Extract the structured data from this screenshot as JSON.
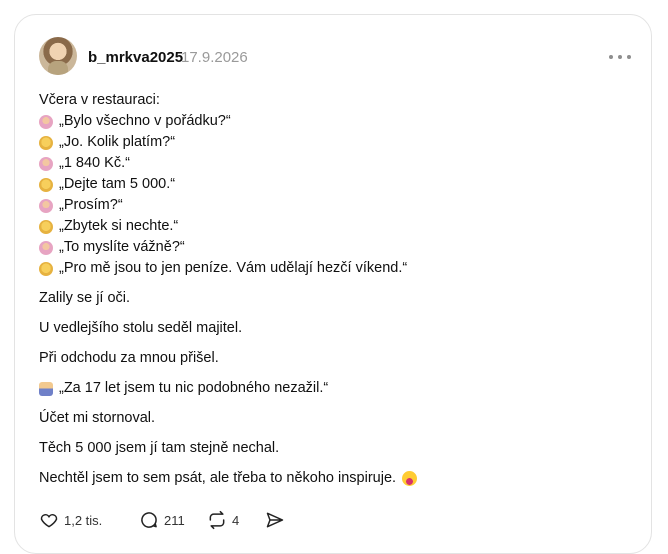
{
  "post": {
    "username": "b_mrkva2025",
    "date": "17.9.2026",
    "lines": [
      {
        "icon": "woman-icon",
        "text": "Včera v restauraci:"
      },
      {
        "icon": "woman-icon",
        "text": "„Bylo všechno v pořádku?“"
      },
      {
        "icon": "man-icon",
        "text": "„Jo. Kolik platím?“"
      },
      {
        "icon": "woman-icon",
        "text": "„1 840 Kč.“"
      },
      {
        "icon": "man-icon",
        "text": "„Dejte tam 5 000.“"
      },
      {
        "icon": "woman-icon",
        "text": "„Prosím?“"
      },
      {
        "icon": "man-icon",
        "text": "„Zbytek si nechte.“"
      },
      {
        "icon": "woman-icon",
        "text": "„To myslíte vážně?“"
      },
      {
        "icon": "man-icon",
        "text": "„Pro mě jsou to jen peníze. Vám udělají hezčí víkend.“"
      }
    ],
    "paragraphs": [
      "Zalily se jí oči.",
      "U vedlejšího stolu seděl majitel.",
      "Při odchodu za mnou přišel.",
      "„Za 17 let jsem tu nic podobného nezažil.“",
      "Účet mi stornoval.",
      "Těch 5 000 jsem jí tam stejně nechal.",
      "Nechtěl jsem to sem psát, ale třeba to někoho inspiruje."
    ],
    "owner_icon": "businessman-icon",
    "end_emoji": "laughing-emoji-icon"
  },
  "actions": {
    "likes": "1,2 tis.",
    "replies": "211",
    "reposts": "4"
  },
  "icons": {
    "like": "heart-icon",
    "reply": "comment-icon",
    "repost": "repost-icon",
    "share": "send-icon",
    "more": "more-options-icon"
  }
}
